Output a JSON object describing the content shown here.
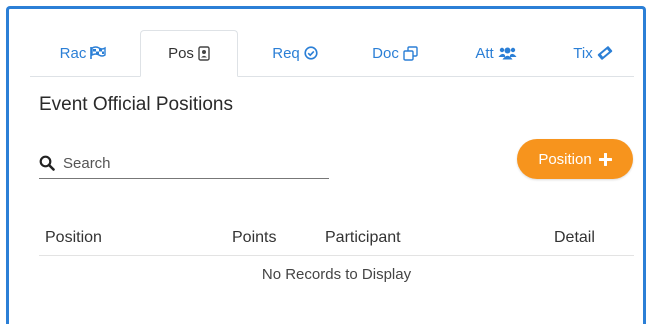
{
  "tabs": [
    {
      "label": "Rac",
      "icon": "flag-checkered-icon",
      "active": false
    },
    {
      "label": "Pos",
      "icon": "id-badge-icon",
      "active": true
    },
    {
      "label": "Req",
      "icon": "check-circle-icon",
      "active": false
    },
    {
      "label": "Doc",
      "icon": "copy-icon",
      "active": false
    },
    {
      "label": "Att",
      "icon": "users-icon",
      "active": false
    },
    {
      "label": "Tix",
      "icon": "ticket-icon",
      "active": false
    }
  ],
  "page_title": "Event Official Positions",
  "search": {
    "placeholder": "Search",
    "value": ""
  },
  "add_button": {
    "label": "Position",
    "icon": "plus-icon"
  },
  "table": {
    "columns": [
      "Position",
      "Points",
      "Participant",
      "Detail"
    ],
    "empty_message": "No Records to Display"
  },
  "colors": {
    "accent": "#2b7fd6",
    "button": "#f7941d",
    "frame": "#2b7fd6"
  }
}
